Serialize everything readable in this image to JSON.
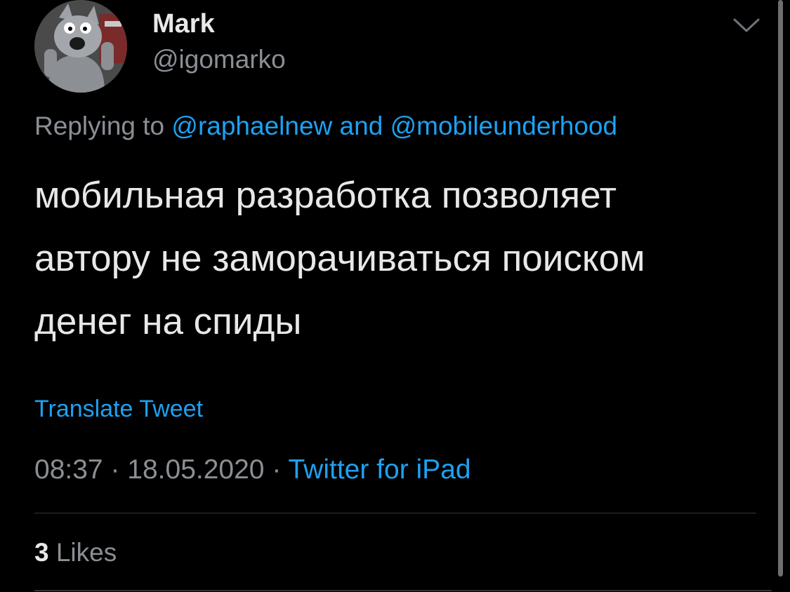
{
  "author": {
    "name": "Mark",
    "handle": "@igomarko",
    "avatar_icon": "cartoon-wolf-avatar"
  },
  "reply": {
    "prefix": "Replying to",
    "mention_1": "@raphaelnew",
    "conjunction": "and",
    "mention_2": "@mobileunderhood"
  },
  "tweet": {
    "lines": [
      "мобильная разработка позволяет",
      "автору не заморачиваться поиском",
      "денег на спиды"
    ]
  },
  "translate_label": "Translate Tweet",
  "meta": {
    "time": "08:37",
    "separator": "·",
    "date": "18.05.2020",
    "source": "Twitter for iPad"
  },
  "stats": {
    "likes_count": "3",
    "likes_label": "Likes"
  },
  "icons": {
    "menu": "chevron-down-icon"
  },
  "colors": {
    "background": "#000000",
    "link": "#1da1f2",
    "secondary_text": "#8b8f94",
    "primary_text": "#e8e8e8"
  }
}
